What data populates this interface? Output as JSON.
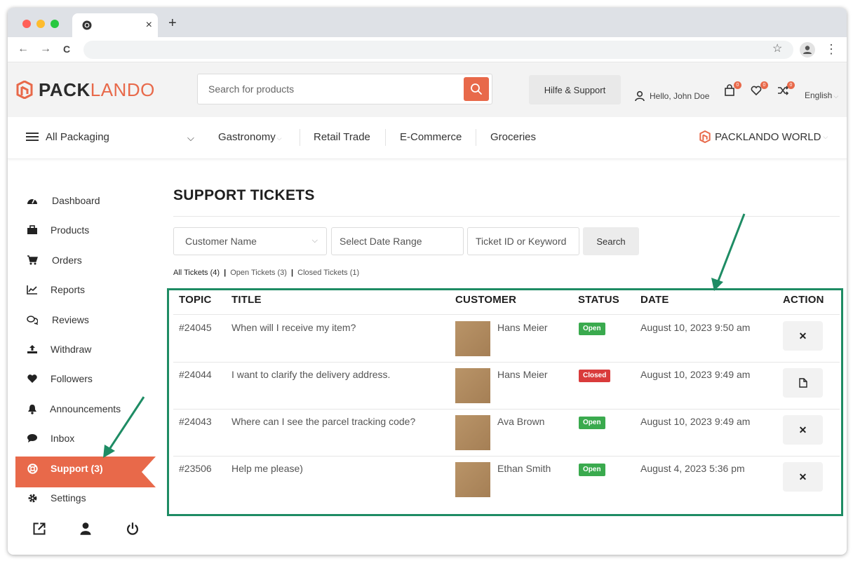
{
  "browser": {
    "tab_close": "×",
    "new_tab": "+",
    "back": "←",
    "forward": "→",
    "reload": "C",
    "bookmark": "☆",
    "menu": "⋮"
  },
  "header": {
    "logo_bold": "PACK",
    "logo_light": "LANDO",
    "search_placeholder": "Search for products",
    "help_label": "Hilfe & Support",
    "user_greeting": "Hello, John Doe",
    "cart_count": "0",
    "wishlist_count": "0",
    "compare_count": "0",
    "language": "English"
  },
  "catnav": {
    "all_label": "All Packaging",
    "items": [
      {
        "label": "Gastronomy"
      },
      {
        "label": "Retail Trade"
      },
      {
        "label": "E-Commerce"
      },
      {
        "label": "Groceries"
      }
    ],
    "world_label": "PACKLANDO WORLD"
  },
  "sidebar": {
    "items": [
      {
        "label": "Dashboard",
        "icon": "tachometer-icon"
      },
      {
        "label": "Products",
        "icon": "briefcase-icon"
      },
      {
        "label": "Orders",
        "icon": "cart-icon"
      },
      {
        "label": "Reports",
        "icon": "chart-icon"
      },
      {
        "label": "Reviews",
        "icon": "comments-icon"
      },
      {
        "label": "Withdraw",
        "icon": "upload-icon"
      },
      {
        "label": "Followers",
        "icon": "heart-icon"
      },
      {
        "label": "Announcements",
        "icon": "bell-icon"
      },
      {
        "label": "Inbox",
        "icon": "chat-icon"
      },
      {
        "label": "Support (3)",
        "icon": "lifebuoy-icon"
      },
      {
        "label": "Settings",
        "icon": "gear-icon"
      }
    ]
  },
  "main": {
    "title": "SUPPORT TICKETS",
    "filters": {
      "customer": "Customer Name",
      "date": "Select Date Range",
      "keyword": "Ticket ID or Keyword",
      "search": "Search"
    },
    "ticket_links": {
      "all": "All Tickets (4)",
      "open": "Open Tickets (3)",
      "closed": "Closed Tickets (1)",
      "separator": "|"
    },
    "columns": [
      "TOPIC",
      "TITLE",
      "CUSTOMER",
      "STATUS",
      "DATE",
      "ACTION"
    ],
    "rows": [
      {
        "topic": "#24045",
        "title": "When will I receive my item?",
        "customer": "Hans Meier",
        "status": "Open",
        "date": "August 10, 2023 9:50 am",
        "action": "close-icon"
      },
      {
        "topic": "#24044",
        "title": "I want to clarify the delivery address.",
        "customer": "Hans Meier",
        "status": "Closed",
        "date": "August 10, 2023 9:49 am",
        "action": "document-icon"
      },
      {
        "topic": "#24043",
        "title": "Where can I see the parcel tracking code?",
        "customer": "Ava Brown",
        "status": "Open",
        "date": "August 10, 2023 9:49 am",
        "action": "close-icon"
      },
      {
        "topic": "#23506",
        "title": "Help me please)",
        "customer": "Ethan Smith",
        "status": "Open",
        "date": "August 4, 2023 5:36 pm",
        "action": "close-icon"
      }
    ]
  },
  "colors": {
    "accent": "#e8694a",
    "annotation": "#1e8c64",
    "open": "#3aaa4e",
    "closed": "#d93b3b"
  }
}
